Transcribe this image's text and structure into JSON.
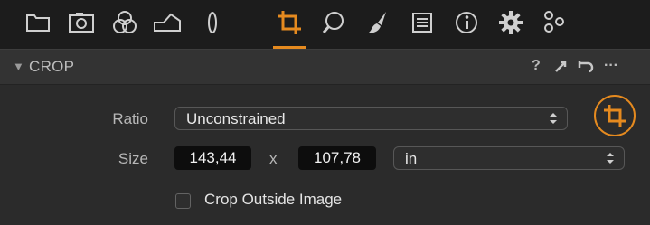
{
  "toolbar": {
    "tools": [
      {
        "icon": "folder-icon"
      },
      {
        "icon": "camera-icon"
      },
      {
        "icon": "color-circles-icon"
      },
      {
        "icon": "exposure-icon"
      },
      {
        "icon": "lens-icon"
      },
      {
        "icon": "crop-icon",
        "active": true
      },
      {
        "icon": "search-icon"
      },
      {
        "icon": "brush-icon"
      },
      {
        "icon": "list-icon"
      },
      {
        "icon": "info-icon"
      },
      {
        "icon": "gear-icon"
      },
      {
        "icon": "advanced-settings-icon"
      }
    ],
    "accent_color": "#e58a1f"
  },
  "panel": {
    "title": "CROP",
    "header_icons": [
      "help-icon",
      "copy-paste-icon",
      "reset-icon",
      "more-icon"
    ],
    "help_label": "?",
    "more_label": "···"
  },
  "crop": {
    "ratio_label": "Ratio",
    "ratio_value": "Unconstrained",
    "size_label": "Size",
    "width": "143,44",
    "times": "x",
    "height": "107,78",
    "unit": "in",
    "crop_outside_label": "Crop Outside Image",
    "crop_outside_checked": false
  }
}
